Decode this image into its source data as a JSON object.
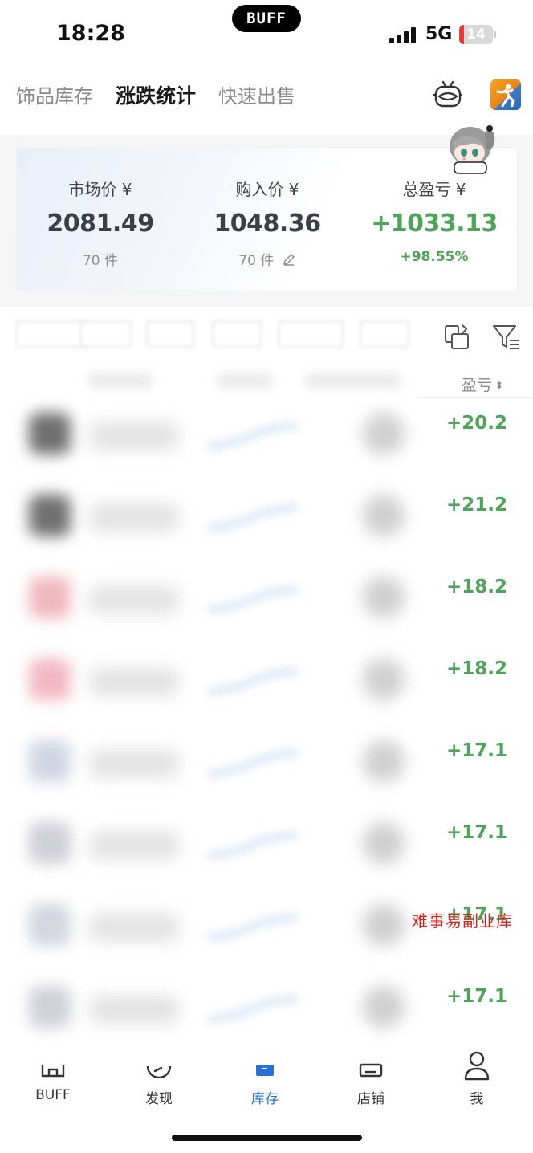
{
  "status_bar": {
    "time": "18:28",
    "island_logo": "BUFF",
    "network": "5G",
    "battery_level": "14",
    "battery_fraction": 0.14,
    "battery_color": "#e23b3b"
  },
  "top_tabs": [
    {
      "label": "饰品库存",
      "active": false
    },
    {
      "label": "涨跌统计",
      "active": true
    },
    {
      "label": "快速出售",
      "active": false
    }
  ],
  "header_icons": {
    "left": "robot-icon",
    "right": "game-icon"
  },
  "summary": {
    "market": {
      "label": "市场价 ¥",
      "value": "2081.49",
      "sub": "70 件"
    },
    "purchase": {
      "label": "购入价 ¥",
      "value": "1048.36",
      "sub": "70 件",
      "edit_icon": "pencil-icon"
    },
    "profit": {
      "label": "总盈亏 ¥",
      "value": "+1033.13",
      "sub": "+98.55%"
    },
    "mascot_icon": "mascot-avatar-icon"
  },
  "list": {
    "sort_label": "盈亏",
    "sort_icon": "sort-arrows-icon",
    "rows": [
      {
        "profit": "+20.2",
        "thumb_color": "#6f6f6f"
      },
      {
        "profit": "+21.2",
        "thumb_color": "#707070"
      },
      {
        "profit": "+18.2",
        "thumb_color": "#f0b8bf"
      },
      {
        "profit": "+18.2",
        "thumb_color": "#f3b8c6"
      },
      {
        "profit": "+17.1",
        "thumb_color": "#d2d5e3"
      },
      {
        "profit": "+17.1",
        "thumb_color": "#cfcfd6"
      },
      {
        "profit": "+17.1",
        "thumb_color": "#d3d5df"
      },
      {
        "profit": "+17.1",
        "thumb_color": "#d0d1d9"
      }
    ]
  },
  "watermark": "难事易副业库",
  "bottom_nav": [
    {
      "label": "BUFF",
      "icon": "buff-home-icon",
      "active": false
    },
    {
      "label": "发现",
      "icon": "discover-icon",
      "active": false
    },
    {
      "label": "库存",
      "icon": "inventory-icon",
      "active": true
    },
    {
      "label": "店铺",
      "icon": "shop-icon",
      "active": false
    },
    {
      "label": "我",
      "icon": "profile-icon",
      "active": false
    }
  ],
  "colors": {
    "profit_green": "#4ea55a",
    "accent_blue": "#2a6fd6"
  }
}
